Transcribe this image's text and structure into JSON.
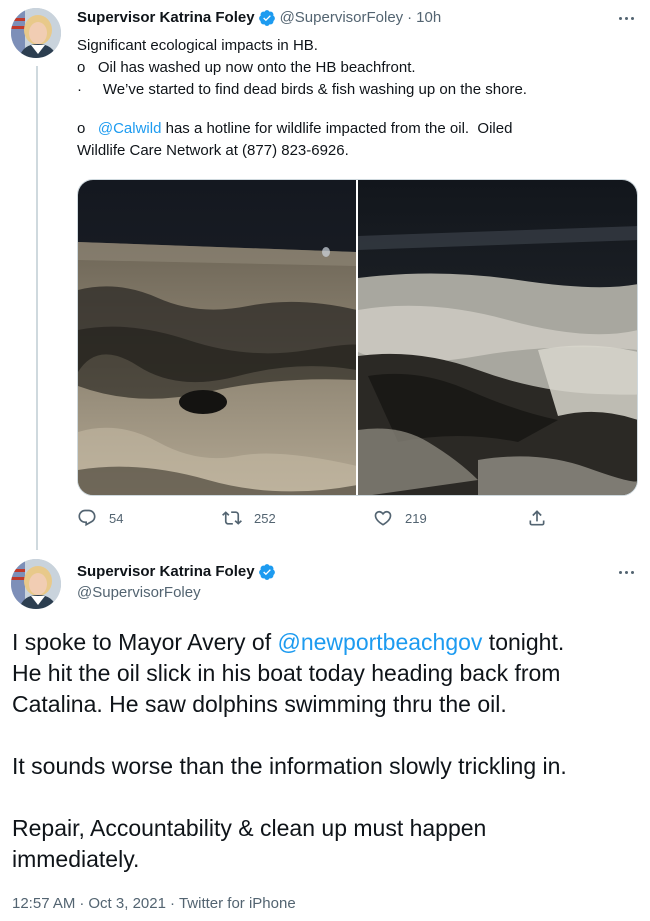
{
  "tweet1": {
    "author_name": "Supervisor Katrina Foley",
    "author_handle": "@SupervisorFoley",
    "time_sep": "·",
    "time": "10h",
    "line1": "Significant ecological impacts in HB.",
    "line2": "o   Oil has washed up now onto the HB beachfront.",
    "line3": "·     We’ve started to find dead birds & fish washing up on the shore.",
    "line4_prefix": "o   ",
    "line4_mention": "@Calwild",
    "line4_suffix": " has a hotline for wildlife impacted from the oil.  Oiled",
    "line5": "Wildlife Care Network at (877) 823-6926.",
    "reply_count": "54",
    "retweet_count": "252",
    "like_count": "219"
  },
  "tweet2": {
    "author_name": "Supervisor Katrina Foley",
    "author_handle": "@SupervisorFoley",
    "line1_prefix": "I spoke to Mayor Avery of ",
    "line1_mention": "@newportbeachgov",
    "line1_suffix": " tonight.",
    "line2": "He hit the oil slick in his boat today heading back from",
    "line3": "Catalina. He saw dolphins swimming thru the oil.",
    "line4": "It sounds worse than the information slowly trickling in.",
    "line5": "Repair, Accountability & clean up must happen",
    "line6": "immediately.",
    "time": "12:57 AM",
    "date": "Oct 3, 2021",
    "sep": "·",
    "client": "Twitter for iPhone"
  },
  "icons": {
    "verified": "verified-badge-icon",
    "more": "more-icon",
    "reply": "reply-icon",
    "retweet": "retweet-icon",
    "like": "heart-icon",
    "share": "share-icon"
  },
  "colors": {
    "link": "#1d9bf0",
    "secondary_text": "#536471",
    "primary_text": "#0f1419",
    "thread_line": "#cfd9de"
  }
}
